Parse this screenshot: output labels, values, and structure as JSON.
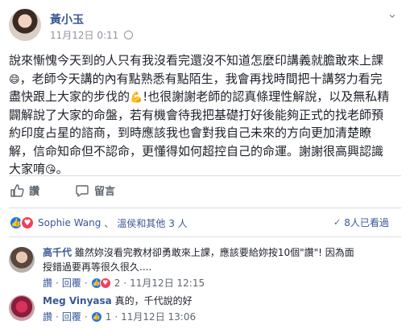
{
  "post": {
    "author": "黃小玉",
    "timestamp": "11月12日 0:11",
    "lines": [
      "說來慚愧今天到的人只有我沒看完還沒不知道怎麼印講義就膽敢來上課",
      "，老師今天講的內有點熟悉有點陌生，我會再找時間把十講努力看完",
      "盡快跟上大家的步伐的",
      "!也很謝謝老師的認真條理性解說，以及無私精",
      "闢解說了大家的命盤，若有機會待我把基礎打好後能夠正式的找老師預",
      "約印度占星的諮商，到時應該我也會對我自己未來的方向更加清楚瞭",
      "解，信命知命但不認命，更懂得如何超控自己的命運。謝謝很高興認識",
      "大家唷"
    ]
  },
  "actions": {
    "like_label": "讚",
    "comment_label": "留言"
  },
  "reactions": {
    "names": "Sophie Wang",
    "others": "溫侯和其他 3 人",
    "shared": "8人已看過"
  },
  "comments": [
    {
      "author": "高千代",
      "text_line1": "雖然妳沒看完教材卻勇敢來上課，應該要給妳按10個\"讚\"! 因為面",
      "text_line2": "授錯過要再等很久很久....",
      "like": "讚",
      "reply": "回覆",
      "count": "2",
      "time": "11月12日 12:15"
    },
    {
      "author": "Meg Vinyasa",
      "text": "真的，千代說的好",
      "like": "讚",
      "reply": "回覆",
      "count": "1",
      "time": "11月12日 13:06"
    }
  ],
  "colors": {
    "link": "#385898",
    "like_blue": "#1877f2",
    "love_red": "#f33e58"
  }
}
